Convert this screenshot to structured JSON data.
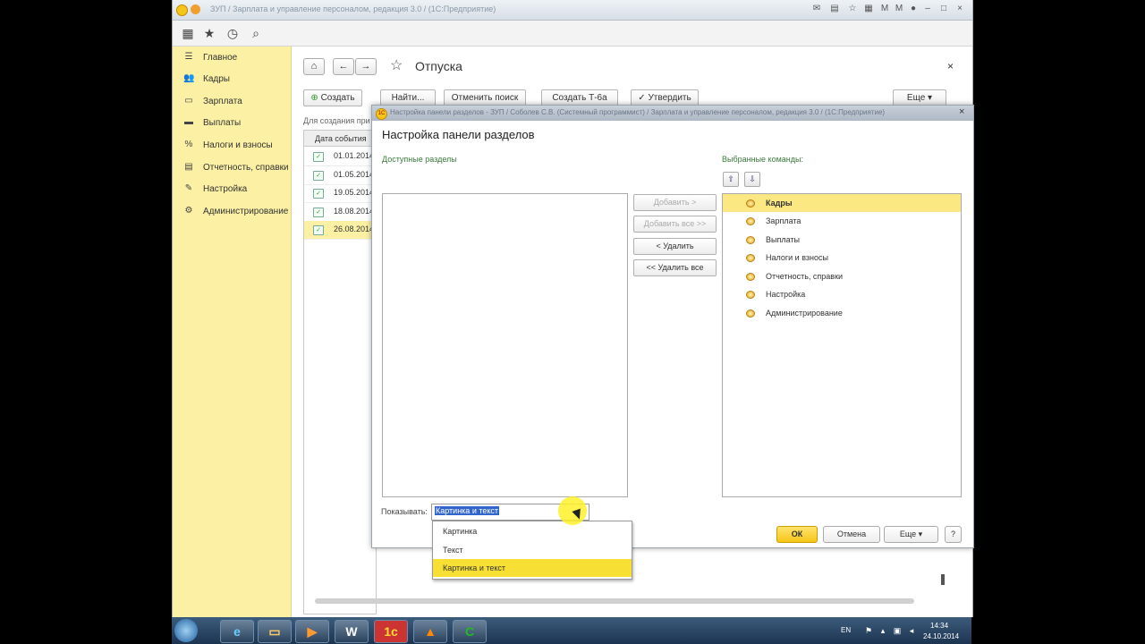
{
  "titlebar": {
    "title": "ЗУП / Зарплата и управление персоналом, редакция 3.0 / (1С:Предприятие)"
  },
  "sidebar": {
    "items": [
      {
        "label": "Главное",
        "icon": "menu-icon"
      },
      {
        "label": "Кадры",
        "icon": "people-icon"
      },
      {
        "label": "Зарплата",
        "icon": "money-icon"
      },
      {
        "label": "Выплаты",
        "icon": "wallet-icon"
      },
      {
        "label": "Налоги и взносы",
        "icon": "percent-icon"
      },
      {
        "label": "Отчетность, справки",
        "icon": "report-icon"
      },
      {
        "label": "Настройка",
        "icon": "wrench-icon"
      },
      {
        "label": "Администрирование",
        "icon": "gear-icon"
      }
    ]
  },
  "page": {
    "title": "Отпуска",
    "buttons": {
      "create": "Создать",
      "find": "Найти...",
      "cancel_search": "Отменить поиск",
      "create_t6a": "Создать Т-6а",
      "approve": "Утвердить",
      "more": "Еще"
    },
    "hint": "Для создания при",
    "grid": {
      "header": "Дата события",
      "rows": [
        "01.01.2014",
        "01.05.2014",
        "19.05.2014",
        "18.08.2014",
        "26.08.2014"
      ]
    }
  },
  "dialog": {
    "window_title": "Настройка панели разделов - ЗУП / Соболев С.В. (Системный программист) / Зарплата и управление персоналом, редакция 3.0 / (1С:Предприятие)",
    "heading": "Настройка панели разделов",
    "available_label": "Доступные разделы",
    "selected_label": "Выбранные команды:",
    "buttons": {
      "add": "Добавить >",
      "add_all": "Добавить все >>",
      "remove": "< Удалить",
      "remove_all": "<< Удалить все",
      "ok": "ОК",
      "cancel": "Отмена",
      "more": "Еще",
      "help": "?"
    },
    "selected_items": [
      "Кадры",
      "Зарплата",
      "Выплаты",
      "Налоги и взносы",
      "Отчетность, справки",
      "Настройка",
      "Администрирование"
    ],
    "show_label": "Показывать:",
    "show_value": "Картинка и текст",
    "show_options": [
      "Картинка",
      "Текст",
      "Картинка и текст"
    ]
  },
  "taskbar": {
    "lang": "EN",
    "time": "14:34",
    "date": "24.10.2014"
  },
  "colors": {
    "sidebar_bg": "#fbf0a4",
    "selection": "#fbe883",
    "ok_button": "#f5c518",
    "label_green": "#3a7a3a"
  }
}
